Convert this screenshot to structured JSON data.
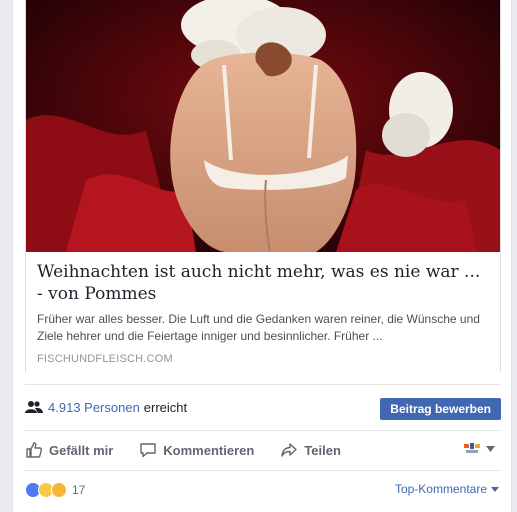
{
  "card": {
    "title": "Weihnachten ist auch nicht mehr, was es nie war ... - von Pommes",
    "description": "Früher war alles besser. Die Luft und die Gedanken waren reiner, die Wünsche und Ziele hehrer und die Feiertage inniger und besinnlicher. Früher ...",
    "source": "FISCHUNDFLEISCH.COM"
  },
  "reach": {
    "count": "4.913 Personen",
    "suffix": "erreicht",
    "promote_label": "Beitrag bewerben"
  },
  "actions": {
    "like_label": "Gefällt mir",
    "comment_label": "Kommentieren",
    "share_label": "Teilen"
  },
  "reactions": {
    "count": "17",
    "sort_label": "Top-Kommentare"
  },
  "colors": {
    "link_blue": "#4267b2",
    "muted_gray": "#606770"
  }
}
